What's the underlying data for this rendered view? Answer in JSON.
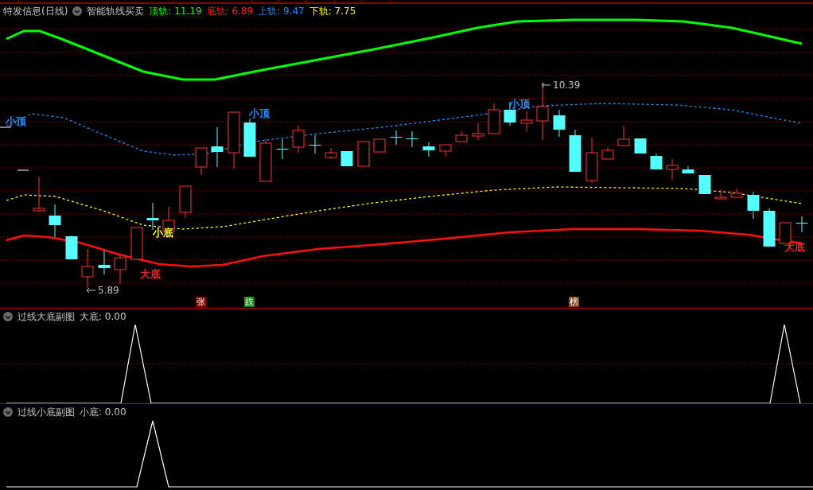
{
  "main_panel": {
    "title": "特发信息(日线)",
    "indicator": "智能轨线买卖",
    "readings": [
      {
        "text": "顶轨: 11.19",
        "color": "#00ff00"
      },
      {
        "text": "底轨: 6.89",
        "color": "#ff2020"
      },
      {
        "text": "上轨: 9.47",
        "color": "#1e90ff"
      },
      {
        "text": "下轨: 7.75",
        "color": "#ffff00"
      }
    ],
    "annotations": [
      {
        "kind": "signal",
        "text": "小顶",
        "color": "#1e90ff"
      },
      {
        "kind": "signal",
        "text": "小顶",
        "color": "#1e90ff"
      },
      {
        "kind": "signal",
        "text": "小顶",
        "color": "#1e90ff"
      },
      {
        "kind": "price",
        "text": "10.39",
        "color": "#c0c0c0"
      },
      {
        "kind": "signal",
        "text": "小底",
        "color": "#ffff00"
      },
      {
        "kind": "signal",
        "text": "大底",
        "color": "#ff2020"
      },
      {
        "kind": "price",
        "text": "5.89",
        "color": "#c0c0c0"
      },
      {
        "kind": "signal",
        "text": "大底",
        "color": "#ff2020"
      }
    ],
    "markers": [
      {
        "text": "张",
        "color": "#8b0000"
      },
      {
        "text": "跌",
        "color": "#118811"
      },
      {
        "text": "榜",
        "color": "#8b4513"
      }
    ]
  },
  "sub_panels": [
    {
      "title": "过线大底副图",
      "reading": "大底: 0.00"
    },
    {
      "title": "过线小底副图",
      "reading": "小底: 0.00"
    }
  ]
}
